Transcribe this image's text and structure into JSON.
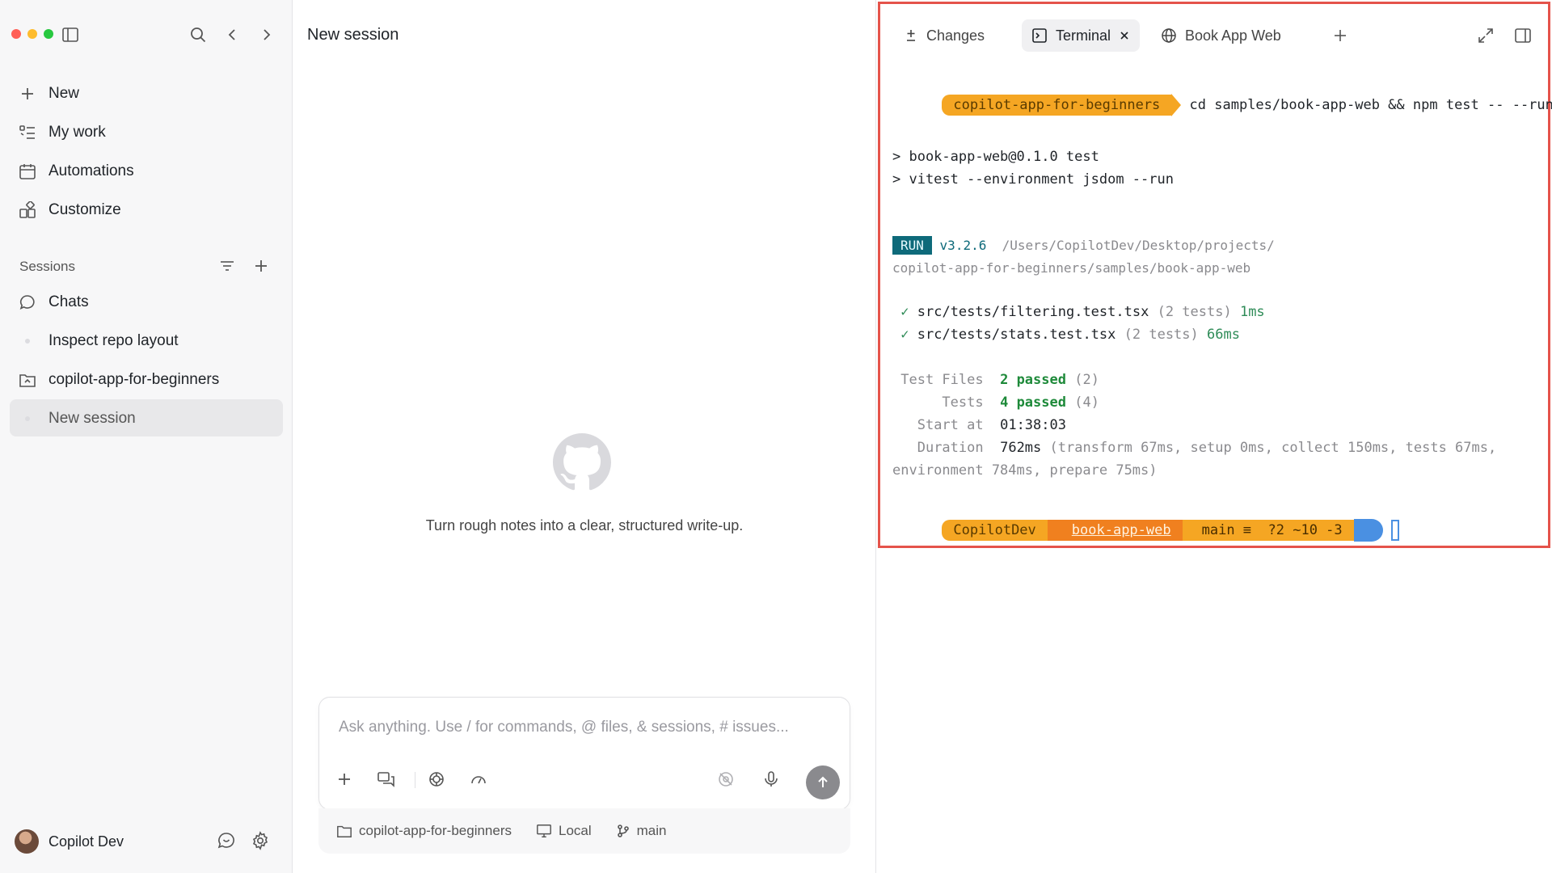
{
  "sidebar": {
    "nav": [
      {
        "label": "New",
        "icon": "plus-icon"
      },
      {
        "label": "My work",
        "icon": "list-icon"
      },
      {
        "label": "Automations",
        "icon": "calendar-icon"
      },
      {
        "label": "Customize",
        "icon": "widgets-icon"
      }
    ],
    "sessions_heading": "Sessions",
    "sessions": [
      {
        "label": "Chats",
        "icon": "chat-bubble-icon"
      },
      {
        "label": "Inspect repo layout",
        "icon": "dot"
      },
      {
        "label": "copilot-app-for-beginners",
        "icon": "folder-icon"
      },
      {
        "label": "New session",
        "icon": "dot",
        "selected": true
      }
    ],
    "user_name": "Copilot Dev"
  },
  "main": {
    "title": "New session",
    "tagline": "Turn rough notes into a clear, structured write-up.",
    "composer_placeholder": "Ask anything. Use / for commands, @ files, & sessions, # issues...",
    "context": {
      "repo": "copilot-app-for-beginners",
      "location": "Local",
      "branch": "main"
    }
  },
  "right": {
    "tabs": [
      {
        "label": "Changes",
        "icon": "plus-minus-icon"
      },
      {
        "label": "Terminal",
        "icon": "terminal-icon",
        "active": true
      },
      {
        "label": "Book App Web",
        "icon": "globe-icon"
      }
    ],
    "terminal": {
      "prompt_dir": "copilot-app-for-beginners",
      "command": "cd samples/book-app-web && npm test -- --run",
      "out1": "> book-app-web@0.1.0 test",
      "out2": "> vitest --environment jsdom --run",
      "run_badge": "RUN",
      "run_version": "v3.2.6",
      "run_path1": "/Users/CopilotDev/Desktop/projects/",
      "run_path2": "copilot-app-for-beginners/samples/book-app-web",
      "test1_file": "src/tests/filtering.test.tsx",
      "test1_count": "(2 tests)",
      "test1_time": "1ms",
      "test2_file": "src/tests/stats.test.tsx",
      "test2_count": "(2 tests)",
      "test2_time": "66ms",
      "files_label": "Test Files",
      "files_value": "2 passed",
      "files_total": "(2)",
      "tests_label": "Tests",
      "tests_value": "4 passed",
      "tests_total": "(4)",
      "start_label": "Start at",
      "start_value": "01:38:03",
      "duration_label": "Duration",
      "duration_value": "762ms",
      "duration_detail": "(transform 67ms, setup 0ms, collect 150ms, tests 67ms,",
      "duration_detail2": "environment 784ms, prepare 75ms)",
      "ps_user": "CopilotDev",
      "ps_dir": "book-app-web",
      "ps_branch": "main ≡",
      "ps_status": "?2 ~10 -3"
    }
  },
  "colors": {
    "accent_orange": "#f5a623",
    "run_teal": "#0e6a7a",
    "pass_green": "#1e8a3a",
    "highlight_red": "#e5534b",
    "prompt_blue": "#4a90e2"
  }
}
